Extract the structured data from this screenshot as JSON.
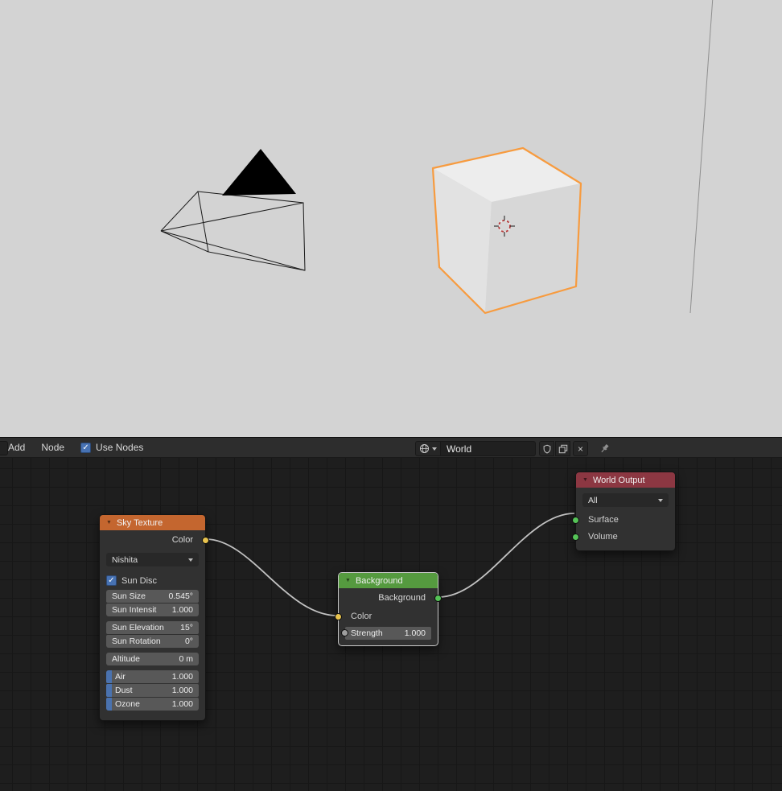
{
  "header": {
    "menu": [
      {
        "label": "Add"
      },
      {
        "label": "Node"
      }
    ],
    "use_nodes_label": "Use Nodes",
    "world_name": "World"
  },
  "icons": {
    "check": "✓",
    "close": "×",
    "collapse": "▼"
  },
  "nodes": {
    "sky_texture": {
      "title": "Sky Texture",
      "output_color": "Color",
      "type_dropdown": "Nishita",
      "sun_disc": "Sun Disc",
      "fields": [
        {
          "label": "Sun Size",
          "value": "0.545°"
        },
        {
          "label": "Sun Intensit",
          "value": "1.000"
        },
        {
          "label": "Sun Elevation",
          "value": "15°"
        },
        {
          "label": "Sun Rotation",
          "value": "0°"
        },
        {
          "label": "Altitude",
          "value": "0 m"
        }
      ],
      "sliders": [
        {
          "label": "Air",
          "value": "1.000"
        },
        {
          "label": "Dust",
          "value": "1.000"
        },
        {
          "label": "Ozone",
          "value": "1.000"
        }
      ]
    },
    "background": {
      "title": "Background",
      "output": "Background",
      "input_color": "Color",
      "strength_label": "Strength",
      "strength_value": "1.000"
    },
    "world_output": {
      "title": "World Output",
      "target_dropdown": "All",
      "input_surface": "Surface",
      "input_volume": "Volume"
    }
  },
  "colors": {
    "sky_header": "#c4662f",
    "background_header": "#559a3f",
    "world_output_header": "#8c3742",
    "selection_outline": "#f79b3f",
    "socket_yellow": "#e8c34e",
    "socket_green": "#55c357",
    "socket_gray": "#9d9d9d",
    "checkbox_blue": "#4772b3",
    "viewport_background": "#d3d3d3",
    "editor_background": "#1e1e1e"
  }
}
